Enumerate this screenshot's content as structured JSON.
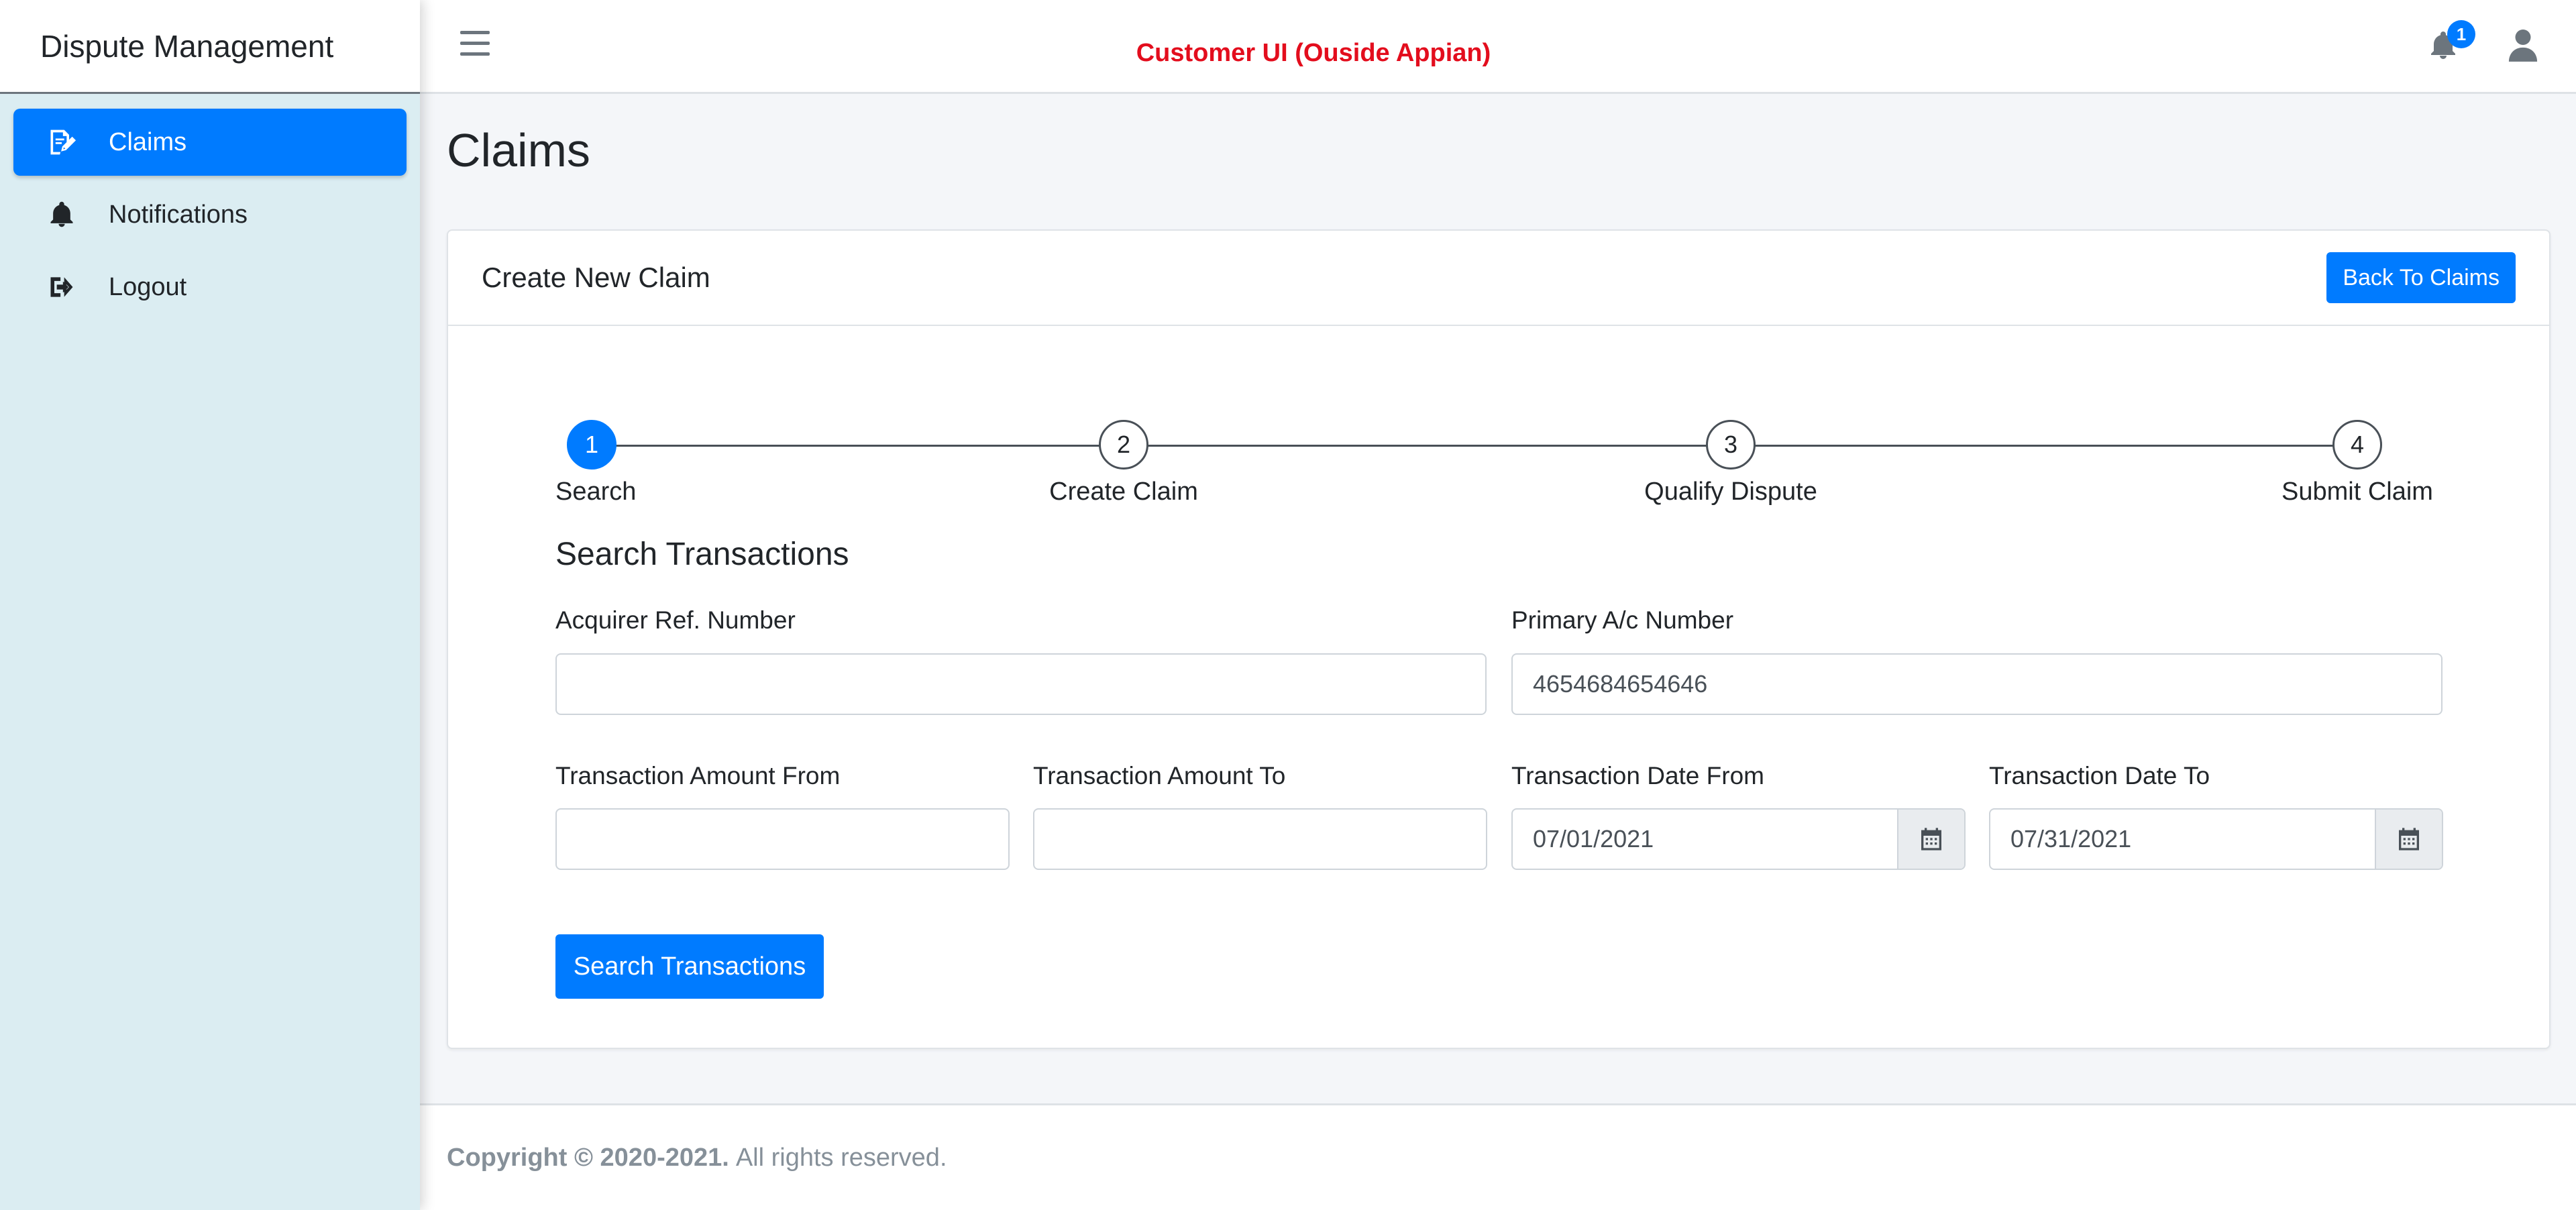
{
  "sidebar": {
    "brand": "Dispute Management",
    "items": [
      {
        "label": "Claims",
        "icon": "edit-document-icon",
        "active": true
      },
      {
        "label": "Notifications",
        "icon": "bell-icon",
        "active": false
      },
      {
        "label": "Logout",
        "icon": "sign-out-icon",
        "active": false
      }
    ]
  },
  "header": {
    "title": "Customer UI (Ouside Appian)",
    "notification_count": "1",
    "title_color": "#e30d1d"
  },
  "page": {
    "title": "Claims"
  },
  "card": {
    "title": "Create New Claim",
    "back_button": "Back To Claims"
  },
  "stepper": {
    "steps": [
      {
        "number": "1",
        "label": "Search",
        "active": true
      },
      {
        "number": "2",
        "label": "Create Claim",
        "active": false
      },
      {
        "number": "3",
        "label": "Qualify Dispute",
        "active": false
      },
      {
        "number": "4",
        "label": "Submit Claim",
        "active": false
      }
    ]
  },
  "form": {
    "section_title": "Search Transactions",
    "acquirer_ref": {
      "label": "Acquirer Ref. Number",
      "value": ""
    },
    "primary_ac": {
      "label": "Primary A/c Number",
      "value": "4654684654646"
    },
    "amount_from": {
      "label": "Transaction Amount From",
      "value": ""
    },
    "amount_to": {
      "label": "Transaction Amount To",
      "value": ""
    },
    "date_from": {
      "label": "Transaction Date From",
      "value": "07/01/2021"
    },
    "date_to": {
      "label": "Transaction Date To",
      "value": "07/31/2021"
    },
    "search_button": "Search Transactions"
  },
  "footer": {
    "copyright": "Copyright © 2020-2021.",
    "rights": "All rights reserved."
  },
  "colors": {
    "primary": "#007bff",
    "sidebar_bg": "#dbedf2",
    "accent_red": "#e30d1d"
  }
}
